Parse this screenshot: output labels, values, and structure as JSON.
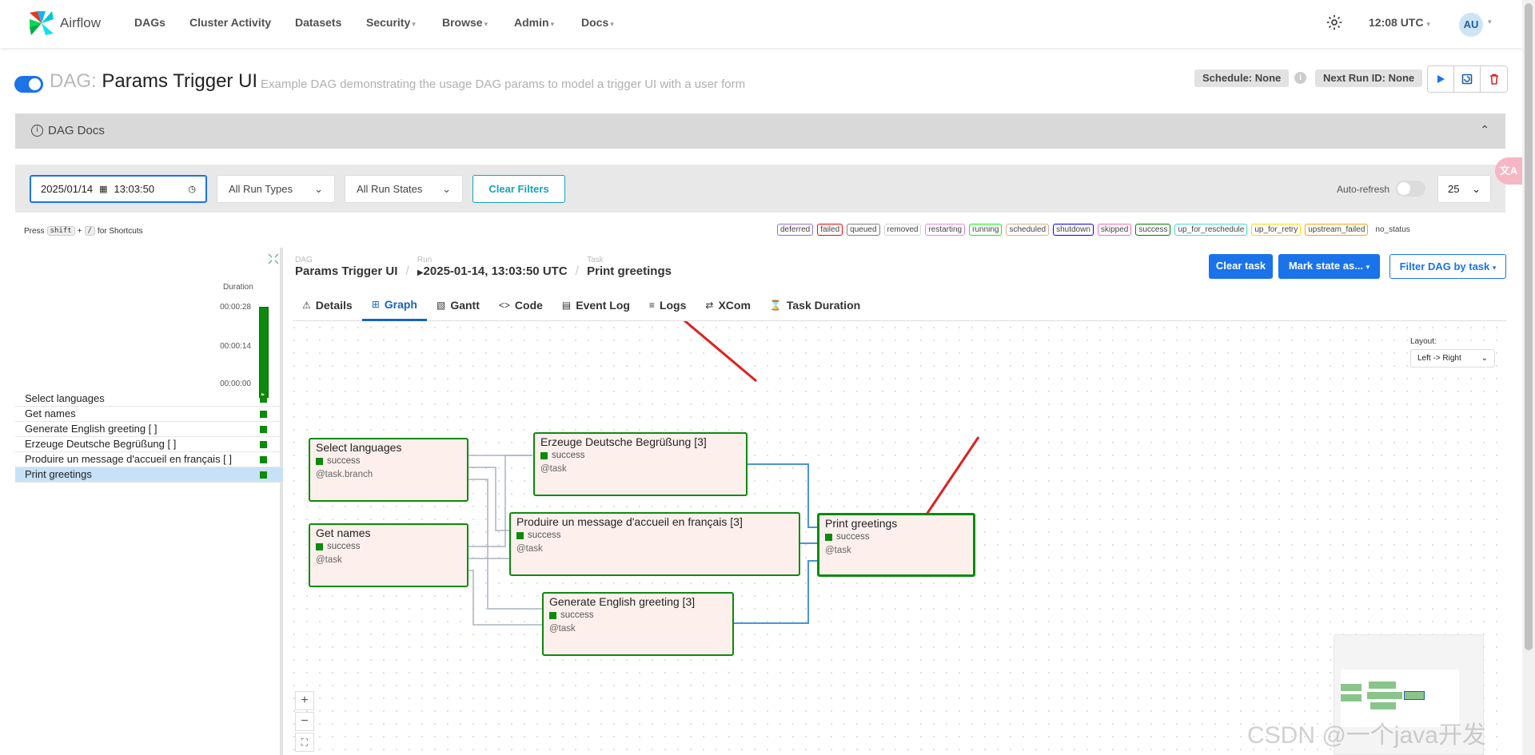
{
  "nav": {
    "brand": "Airflow",
    "items": [
      {
        "label": "DAGs",
        "dropdown": false
      },
      {
        "label": "Cluster Activity",
        "dropdown": false
      },
      {
        "label": "Datasets",
        "dropdown": false
      },
      {
        "label": "Security",
        "dropdown": true
      },
      {
        "label": "Browse",
        "dropdown": true
      },
      {
        "label": "Admin",
        "dropdown": true
      },
      {
        "label": "Docs",
        "dropdown": true
      }
    ],
    "clock": "12:08 UTC",
    "avatar": "AU"
  },
  "dag": {
    "prefix": "DAG:",
    "name": "Params Trigger UI",
    "description": "Example DAG demonstrating the usage DAG params to model a trigger UI with a user form",
    "schedule": "Schedule: None",
    "next_run": "Next Run ID: None",
    "docs_label": "DAG Docs"
  },
  "filters": {
    "date": "2025/01/14",
    "time": "13:03:50",
    "run_types": "All Run Types",
    "run_states": "All Run States",
    "clear": "Clear Filters",
    "auto_refresh": "Auto-refresh",
    "page_size": "25"
  },
  "shortcut": {
    "press": "Press",
    "shift": "shift",
    "plus": "+",
    "slash": "/",
    "for": "for Shortcuts"
  },
  "legend": [
    {
      "label": "deferred",
      "color": "#9370db"
    },
    {
      "label": "failed",
      "color": "#ff0000"
    },
    {
      "label": "queued",
      "color": "#808080"
    },
    {
      "label": "removed",
      "color": "#d3d3d3"
    },
    {
      "label": "restarting",
      "color": "#ee82ee"
    },
    {
      "label": "running",
      "color": "#00ff00"
    },
    {
      "label": "scheduled",
      "color": "#d2b48c"
    },
    {
      "label": "shutdown",
      "color": "#0000ff"
    },
    {
      "label": "skipped",
      "color": "#ff69b4"
    },
    {
      "label": "success",
      "color": "#008000"
    },
    {
      "label": "up_for_reschedule",
      "color": "#40e0d0"
    },
    {
      "label": "up_for_retry",
      "color": "#ffd700"
    },
    {
      "label": "upstream_failed",
      "color": "#ffa500"
    },
    {
      "label": "no_status",
      "color": "transparent"
    }
  ],
  "grid": {
    "duration_label": "Duration",
    "ticks": [
      "00:00:28",
      "00:00:14",
      "00:00:00"
    ],
    "tasks": [
      {
        "label": "Select languages",
        "selected": false
      },
      {
        "label": "Get names",
        "selected": false
      },
      {
        "label": "Generate English greeting [ ]",
        "selected": false
      },
      {
        "label": "Erzeuge Deutsche Begrüßung [ ]",
        "selected": false
      },
      {
        "label": "Produire un message d'accueil en français [ ]",
        "selected": false
      },
      {
        "label": "Print greetings",
        "selected": true
      }
    ]
  },
  "breadcrumb": {
    "dag_key": "DAG",
    "dag_val": "Params Trigger UI",
    "run_key": "Run",
    "run_val": "2025-01-14, 13:03:50 UTC",
    "task_key": "Task",
    "task_val": "Print greetings"
  },
  "actions": {
    "clear_task": "Clear task",
    "mark_state": "Mark state as...",
    "filter_dag": "Filter DAG by task"
  },
  "tabs": [
    {
      "label": "Details",
      "icon": "warning-icon",
      "glyph": "⚠",
      "active": false
    },
    {
      "label": "Graph",
      "icon": "graph-icon",
      "glyph": "⊞",
      "active": true
    },
    {
      "label": "Gantt",
      "icon": "gantt-icon",
      "glyph": "▧",
      "active": false
    },
    {
      "label": "Code",
      "icon": "code-icon",
      "glyph": "<>",
      "active": false
    },
    {
      "label": "Event Log",
      "icon": "calendar-icon",
      "glyph": "▤",
      "active": false
    },
    {
      "label": "Logs",
      "icon": "list-icon",
      "glyph": "≡",
      "active": false
    },
    {
      "label": "XCom",
      "icon": "exchange-icon",
      "glyph": "⇄",
      "active": false
    },
    {
      "label": "Task Duration",
      "icon": "hourglass-icon",
      "glyph": "⌛",
      "active": false
    }
  ],
  "graph": {
    "layout_label": "Layout:",
    "layout_value": "Left -> Right",
    "nodes": [
      {
        "id": "select_languages",
        "name": "Select languages",
        "status": "success",
        "op": "@task.branch"
      },
      {
        "id": "get_names",
        "name": "Get names",
        "status": "success",
        "op": "@task"
      },
      {
        "id": "german",
        "name": "Erzeuge Deutsche Begrüßung [3]",
        "status": "success",
        "op": "@task"
      },
      {
        "id": "french",
        "name": "Produire un message d'accueil en français [3]",
        "status": "success",
        "op": "@task"
      },
      {
        "id": "english",
        "name": "Generate English greeting [3]",
        "status": "success",
        "op": "@task"
      },
      {
        "id": "print",
        "name": "Print greetings",
        "status": "success",
        "op": "@task"
      }
    ],
    "zoom": {
      "in": "+",
      "out": "−",
      "fit": "⛶"
    }
  },
  "colors": {
    "success": "#008000",
    "primary": "#1a73e8",
    "info": "#17a2b8",
    "arrow": "#e02020"
  },
  "watermark": "CSDN @一个java开发"
}
